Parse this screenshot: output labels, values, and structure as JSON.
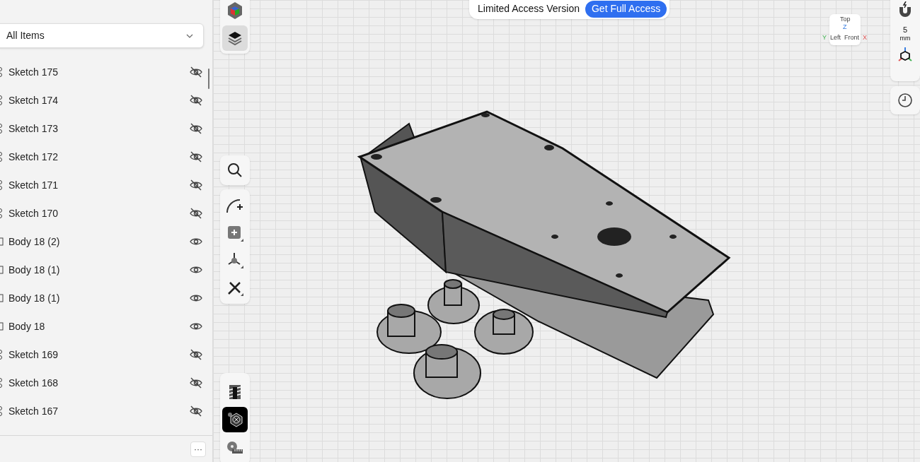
{
  "sidebar": {
    "filter": {
      "value": "All Items"
    },
    "items": [
      {
        "kind": "sketch",
        "label": "Sketch 175",
        "visible": false
      },
      {
        "kind": "sketch",
        "label": "Sketch 174",
        "visible": false
      },
      {
        "kind": "sketch",
        "label": "Sketch 173",
        "visible": false
      },
      {
        "kind": "sketch",
        "label": "Sketch 172",
        "visible": false
      },
      {
        "kind": "sketch",
        "label": "Sketch 171",
        "visible": false
      },
      {
        "kind": "sketch",
        "label": "Sketch 170",
        "visible": false
      },
      {
        "kind": "body",
        "label": "Body 18 (2)",
        "visible": true
      },
      {
        "kind": "body",
        "label": "Body 18 (1)",
        "visible": true
      },
      {
        "kind": "body",
        "label": "Body 18 (1)",
        "visible": true
      },
      {
        "kind": "body",
        "label": "Body 18",
        "visible": true
      },
      {
        "kind": "sketch",
        "label": "Sketch 169",
        "visible": false
      },
      {
        "kind": "sketch",
        "label": "Sketch 168",
        "visible": false
      },
      {
        "kind": "sketch",
        "label": "Sketch 167",
        "visible": false
      }
    ],
    "more_button": "···"
  },
  "banner": {
    "text": "Limited Access Version",
    "button": "Get Full Access"
  },
  "toolbar": {
    "top": [
      {
        "kind": "cube",
        "selected": false
      },
      {
        "kind": "layers",
        "selected": true
      }
    ],
    "bottom": [
      {
        "kind": "thread",
        "selected": false
      },
      {
        "kind": "nut",
        "selected": true
      },
      {
        "kind": "tape",
        "selected": false
      }
    ]
  },
  "view_cube": {
    "faces": [
      "Top",
      "Left",
      "Front"
    ],
    "axes": [
      "Z",
      "Y",
      "X"
    ]
  },
  "right_panel": {
    "snap_value": "5",
    "snap_unit": "mm"
  }
}
